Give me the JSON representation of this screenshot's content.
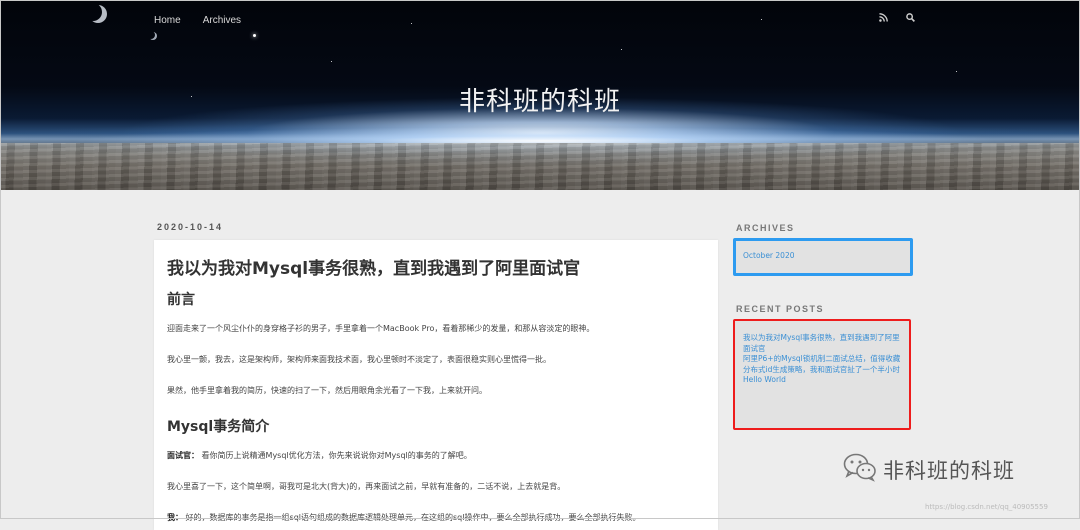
{
  "nav": {
    "home": "Home",
    "archives": "Archives"
  },
  "icons": {
    "rss": "rss-icon",
    "search": "search-icon"
  },
  "site": {
    "title": "非科班的科班"
  },
  "post": {
    "date": "2020-10-14",
    "title": "我以为我对Mysql事务很熟，直到我遇到了阿里面试官",
    "section1": "前言",
    "p1": "迎面走来了一个风尘仆仆的身穿格子衫的男子，手里拿着一个MacBook Pro，看着那稀少的发量，和那从容淡定的眼神。",
    "p2": "我心里一颤，我去，这是架构师，架构师来面我技术面，我心里顿时不淡定了，表面很稳实则心里慌得一批。",
    "p3": "果然，他手里拿着我的简历，快速的扫了一下，然后用眼角余光看了一下我，上来就开问。",
    "section2": "Mysql事务简介",
    "p4_speaker": "面试官：",
    "p4": "看你简历上说精通Mysql优化方法，你先来说说你对Mysql的事务的了解吧。",
    "p5": "我心里喜了一下，这个简单啊，哥我可是北大(背大)的，再来面试之前，早就有准备的，二话不说，上去就是背。",
    "p6_speaker": "我：",
    "p6": "好的，数据库的事务是指一组sql语句组成的数据库逻辑处理单元，在这组的sql操作中，要么全部执行成功，要么全部执行失败。"
  },
  "sidebar": {
    "archives_heading": "ARCHIVES",
    "archives": [
      "October 2020"
    ],
    "recent_heading": "RECENT POSTS",
    "recent": [
      "我以为我对Mysql事务很熟，直到我遇到了阿里面试官",
      "阿里P6+的Mysql锁机制二面试总结，值得收藏",
      "分布式id生成策略，我和面试官扯了一个半小时",
      "Hello World"
    ]
  },
  "watermark": {
    "text": "非科班的科班",
    "url": "https://blog.csdn.net/qq_40905559"
  },
  "colors": {
    "archives_border": "#2d9bf0",
    "recent_border": "#ee1c1c",
    "link": "#3a8fd4"
  }
}
